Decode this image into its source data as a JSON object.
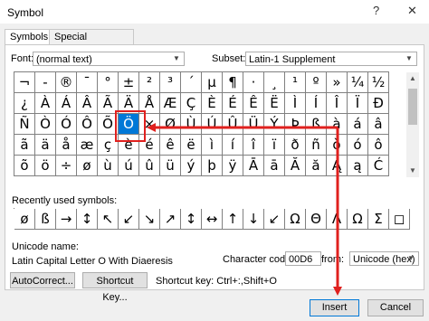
{
  "window": {
    "title": "Symbol",
    "help_icon": "?",
    "close_icon": "✕"
  },
  "tabs": [
    {
      "label": "Symbols"
    },
    {
      "label": "Special Characters"
    }
  ],
  "font": {
    "label": "Font:",
    "value": "(normal text)"
  },
  "subset": {
    "label": "Subset:",
    "value": "Latin-1 Supplement"
  },
  "grid_rows": [
    [
      "¬",
      "-",
      "®",
      "¯",
      "°",
      "±",
      "²",
      "³",
      "´",
      "µ",
      "¶",
      "·",
      "¸",
      "¹",
      "º",
      "»",
      "¼",
      "½",
      "¾"
    ],
    [
      "¿",
      "À",
      "Á",
      "Â",
      "Ã",
      "Ä",
      "Å",
      "Æ",
      "Ç",
      "È",
      "É",
      "Ê",
      "Ë",
      "Ì",
      "Í",
      "Î",
      "Ï",
      "Ð"
    ],
    [
      "Ñ",
      "Ò",
      "Ó",
      "Ô",
      "Õ",
      "Ö",
      "×",
      "Ø",
      "Ù",
      "Ú",
      "Û",
      "Ü",
      "Ý",
      "Þ",
      "ß",
      "à",
      "á",
      "â"
    ],
    [
      "ã",
      "ä",
      "å",
      "æ",
      "ç",
      "è",
      "é",
      "ê",
      "ë",
      "ì",
      "í",
      "î",
      "ï",
      "ð",
      "ñ",
      "ò",
      "ó",
      "ô"
    ],
    [
      "õ",
      "ö",
      "÷",
      "ø",
      "ù",
      "ú",
      "û",
      "ü",
      "ý",
      "þ",
      "ÿ",
      "Ā",
      "ā",
      "Ă",
      "ă",
      "Ą",
      "ą",
      "Ć"
    ]
  ],
  "selected_symbol": "Ö",
  "recent": {
    "label": "Recently used symbols:",
    "symbols": [
      "ø",
      "ß",
      "→",
      "↕",
      "↖",
      "↙",
      "↘",
      "↗",
      "↕",
      "↔",
      "↑",
      "↓",
      "↙",
      "Ω",
      "Θ",
      "Λ",
      "Ω",
      "Σ",
      "◻"
    ]
  },
  "unicode": {
    "label": "Unicode name:",
    "name": "Latin Capital Letter O With Diaeresis"
  },
  "char_code": {
    "label": "Character code:",
    "value": "00D6"
  },
  "from": {
    "label": "from:",
    "value": "Unicode (hex)"
  },
  "buttons": {
    "autocorrect": "AutoCorrect...",
    "shortcut_key": "Shortcut Key...",
    "insert": "Insert",
    "cancel": "Cancel"
  },
  "shortcut_text": "Shortcut key: Ctrl+:,Shift+O",
  "accent_color": "#0078d7",
  "annotation_color": "#e0201e"
}
